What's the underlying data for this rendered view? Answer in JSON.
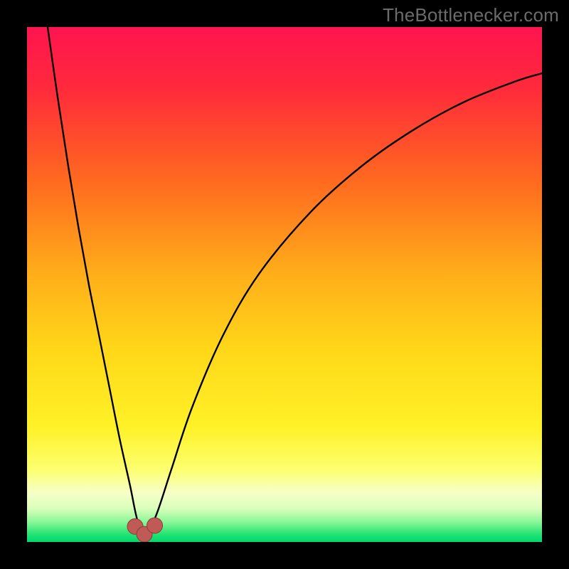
{
  "watermark": {
    "text": "TheBottlenecker.com"
  },
  "colors": {
    "page_bg": "#000000",
    "curve": "#000000",
    "marker_fill": "#bf5a57",
    "marker_stroke": "#8f3a38",
    "gradient_stops": [
      {
        "offset": 0.0,
        "color": "#ff1450"
      },
      {
        "offset": 0.12,
        "color": "#ff2a3b"
      },
      {
        "offset": 0.3,
        "color": "#ff6a1f"
      },
      {
        "offset": 0.48,
        "color": "#ffae1a"
      },
      {
        "offset": 0.63,
        "color": "#ffd818"
      },
      {
        "offset": 0.78,
        "color": "#fff229"
      },
      {
        "offset": 0.86,
        "color": "#fcff70"
      },
      {
        "offset": 0.905,
        "color": "#f7ffc8"
      },
      {
        "offset": 0.935,
        "color": "#d9ffba"
      },
      {
        "offset": 0.96,
        "color": "#8ef79a"
      },
      {
        "offset": 0.985,
        "color": "#23e472"
      },
      {
        "offset": 1.0,
        "color": "#00d870"
      }
    ]
  },
  "chart_data": {
    "type": "line",
    "title": "",
    "xlabel": "",
    "ylabel": "",
    "xlim": [
      0,
      100
    ],
    "ylim": [
      0,
      100
    ],
    "grid": false,
    "legend": false,
    "series": [
      {
        "name": "bottleneck-curve",
        "x": [
          4,
          6,
          8,
          10,
          12,
          14,
          16,
          18,
          20,
          21.5,
          23,
          25,
          28,
          32,
          38,
          45,
          55,
          65,
          75,
          85,
          95,
          100
        ],
        "values": [
          100,
          86,
          73,
          61,
          50,
          40,
          30,
          20,
          11,
          4,
          2,
          5,
          14,
          26,
          40,
          52,
          64,
          73,
          80,
          85.5,
          89.5,
          91
        ]
      }
    ],
    "markers": [
      {
        "name": "min-left",
        "x": 21.0,
        "y": 3.0
      },
      {
        "name": "min-center",
        "x": 22.8,
        "y": 1.5
      },
      {
        "name": "min-right",
        "x": 24.8,
        "y": 3.2
      }
    ],
    "annotations": []
  }
}
